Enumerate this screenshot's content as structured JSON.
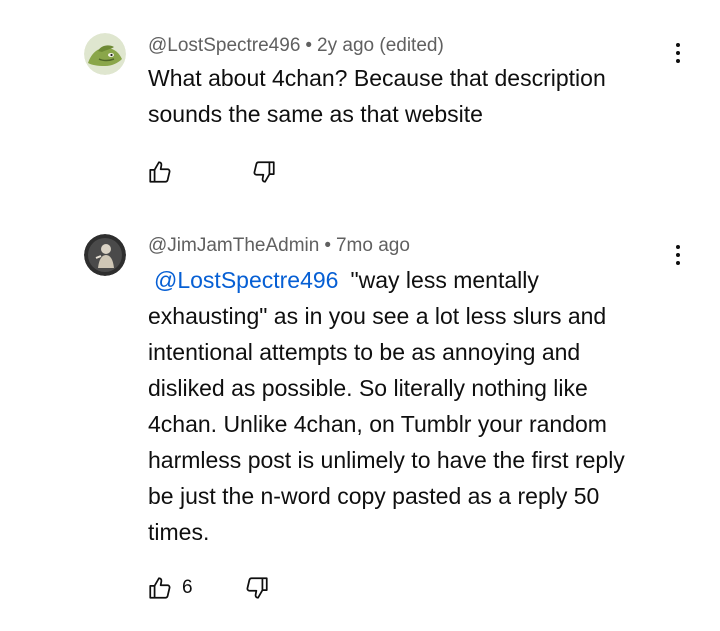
{
  "comments": [
    {
      "author": "@LostSpectre496",
      "separator": "•",
      "time": "2y ago (edited)",
      "text": "What about 4chan? Because that description\nsounds the same as that website",
      "like_count": "",
      "avatar_icon": "green-character-avatar",
      "accent": "#8aa64a"
    },
    {
      "author": "@JimJamTheAdmin",
      "separator": "•",
      "time": "7mo ago",
      "mention": "@LostSpectre496",
      "text": "\"way less mentally\nexhausting\" as in you see a lot less slurs and\nintentional attempts to be as annoying and\ndisliked as possible. So literally nothing like\n4chan. Unlike 4chan, on Tumblr your random\nharmless post is unlimely to have the first reply\nbe just the n-word copy pasted as a reply 50\ntimes.",
      "like_count": "6",
      "avatar_icon": "dark-figure-avatar",
      "accent": "#2a2a2a"
    }
  ],
  "colors": {
    "mention": "#065fd4",
    "meta_text": "#606060",
    "body_text": "#0f0f0f"
  },
  "icons": [
    "like-icon",
    "dislike-icon",
    "more-options-icon"
  ]
}
